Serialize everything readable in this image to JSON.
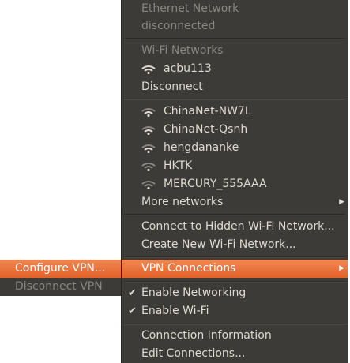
{
  "ethernet": {
    "header": "Ethernet Network",
    "status": "disconnected"
  },
  "wifi": {
    "header": "Wi-Fi Networks",
    "connected": "acbu113",
    "disconnect": "Disconnect",
    "networks": [
      "ChinaNet-NW7L",
      "ChinaNet-Qsnh",
      "hengdananke",
      "HKTK",
      "MERCURY_555AAA"
    ],
    "more": "More networks",
    "connect_hidden": "Connect to Hidden Wi-Fi Network...",
    "create_new": "Create New Wi-Fi Network..."
  },
  "vpn": {
    "label": "VPN Connections",
    "configure": "Configure VPN...",
    "disconnect": "Disconnect VPN"
  },
  "toggles": {
    "enable_networking": "Enable Networking",
    "enable_wifi": "Enable Wi-Fi"
  },
  "footer": {
    "connection_info": "Connection Information",
    "edit_connections": "Edit Connections..."
  },
  "icons": {
    "wifi": "wifi-signal-icon",
    "submenu_arrow": "arrow-right-icon",
    "check": "check-icon"
  },
  "colors": {
    "menu_bg": "#3c3b37",
    "text": "#dfdbd2",
    "disabled_text": "#8a8780",
    "highlight": "#e9703a"
  }
}
